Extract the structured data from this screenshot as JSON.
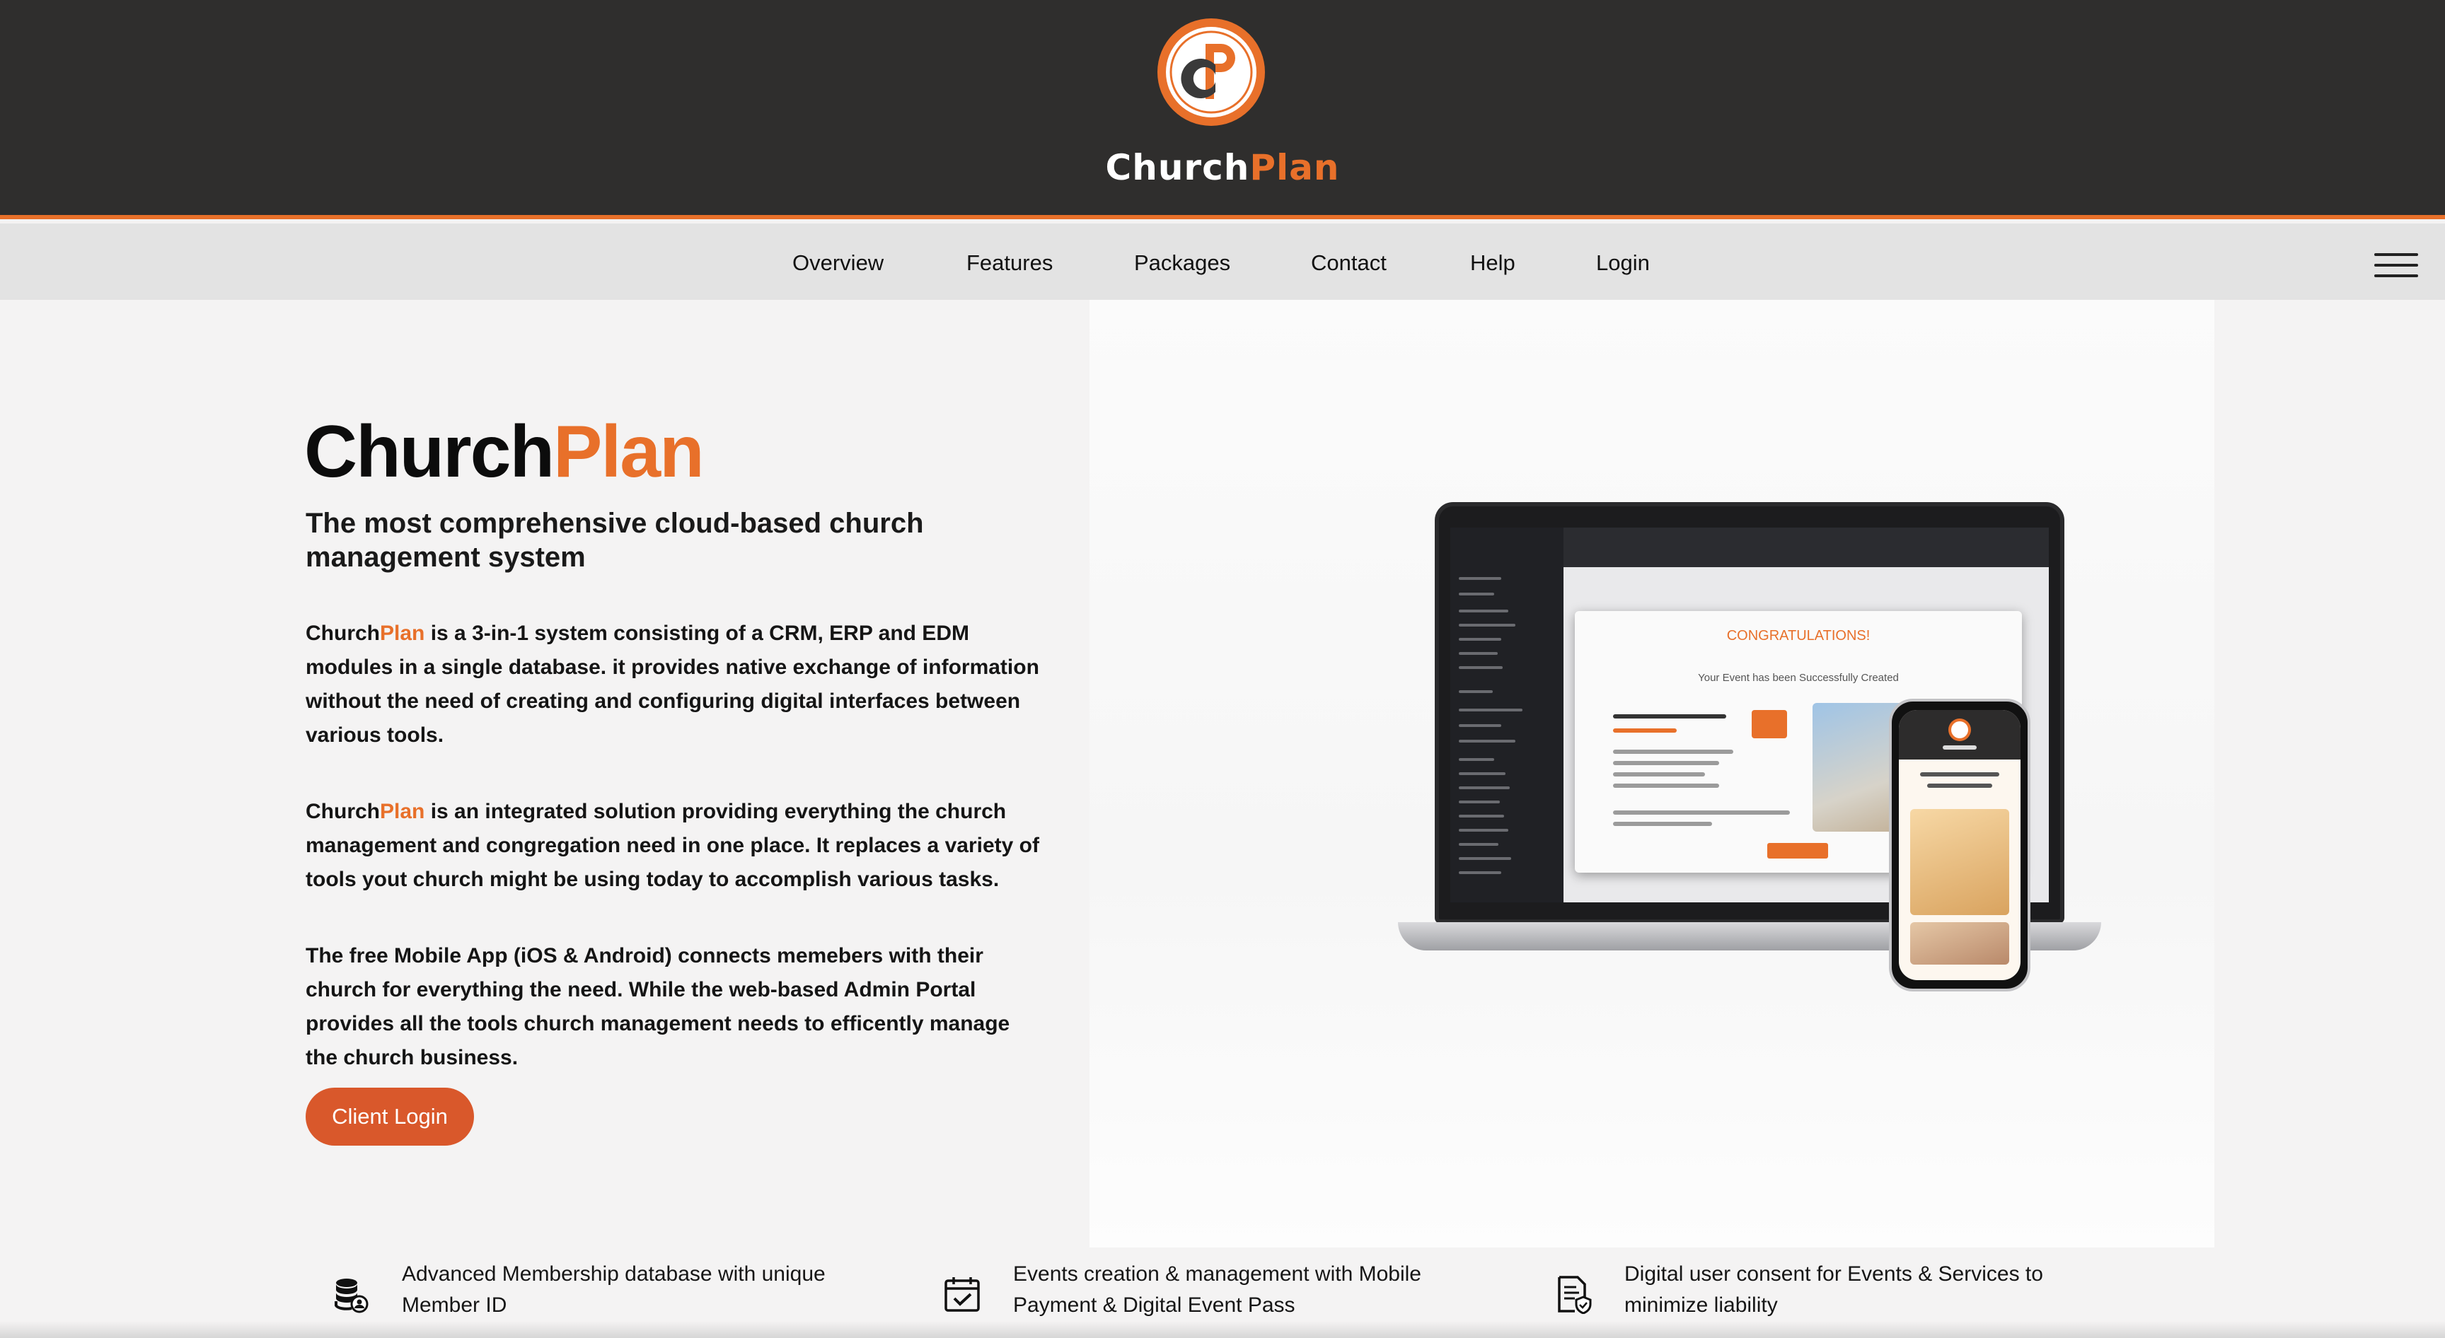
{
  "brand": {
    "name_part1": "Church",
    "name_part2": "Plan",
    "accent_color": "#e8702a",
    "header_bg": "#2f2e2d"
  },
  "nav": {
    "items": [
      {
        "label": "Overview"
      },
      {
        "label": "Features"
      },
      {
        "label": "Packages"
      },
      {
        "label": "Contact"
      },
      {
        "label": "Help"
      },
      {
        "label": "Login"
      }
    ],
    "menu_icon": "hamburger-icon"
  },
  "hero": {
    "title_part1": "Church",
    "title_part2": "Plan",
    "subtitle": "The most comprehensive cloud-based church management system",
    "para1_brand1": "Church",
    "para1_brand2": "Plan",
    "para1_text": " is a 3-in-1 system consisting of a CRM, ERP and EDM modules in a single database. it provides native exchange of information without the need of creating and configuring digital interfaces between various tools.",
    "para2_brand1": "Church",
    "para2_brand2": "Plan",
    "para2_text": " is an integrated solution providing everything the church management and congregation need in one place. It replaces a variety of tools yout church might be using today to accomplish various tasks.",
    "para3_text": "The free Mobile App (iOS & Android) connects memebers with their church for everything the need. While the web-based Admin Portal provides all the tools church management needs to efficently manage the church business.",
    "cta_label": "Client Login",
    "cta_color": "#d9582b"
  },
  "mockup": {
    "modal_title": "CONGRATULATIONS!",
    "modal_text": "Your Event has been Successfully Created"
  },
  "features": [
    {
      "icon": "database-user-icon",
      "text": "Advanced Membership database with unique Member ID"
    },
    {
      "icon": "calendar-check-icon",
      "text": "Events creation & management with Mobile Payment & Digital Event Pass"
    },
    {
      "icon": "document-shield-icon",
      "text": "Digital user consent for Events & Services to minimize liability"
    }
  ]
}
